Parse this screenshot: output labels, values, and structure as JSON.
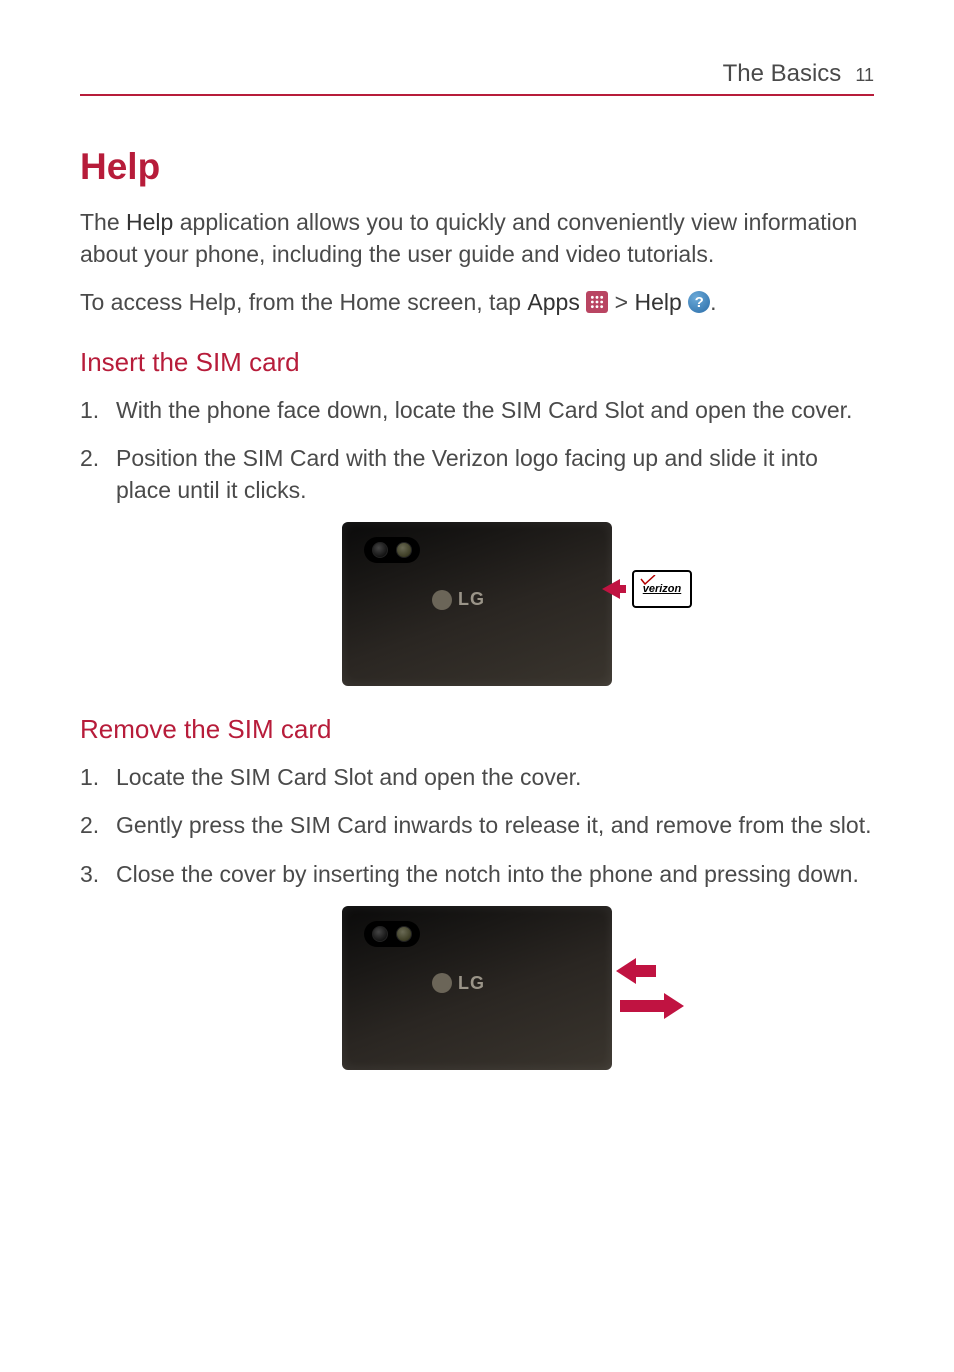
{
  "header": {
    "section": "The Basics",
    "page": "11"
  },
  "help": {
    "title": "Help",
    "intro_pre": "The ",
    "intro_bold": "Help",
    "intro_post": " application allows you to quickly and conveniently view information about your phone, including the user guide and video tutorials.",
    "access_pre": "To access Help, from the Home screen, tap ",
    "apps_label": "Apps",
    "sep": " > ",
    "help_label": "Help",
    "access_post": "."
  },
  "insert": {
    "heading": "Insert the SIM card",
    "steps": [
      "With the phone face down, locate the SIM Card Slot and open the cover.",
      "Position the SIM Card with the Verizon logo facing up and slide it into place until it clicks."
    ]
  },
  "remove": {
    "heading": "Remove the SIM card",
    "steps": [
      "Locate the SIM Card Slot and open the cover.",
      "Gently press the SIM Card inwards to release it, and remove from the slot.",
      "Close the cover by inserting the notch into the phone and pressing down."
    ]
  },
  "figure": {
    "lg": "LG",
    "verizon": "verizon"
  }
}
